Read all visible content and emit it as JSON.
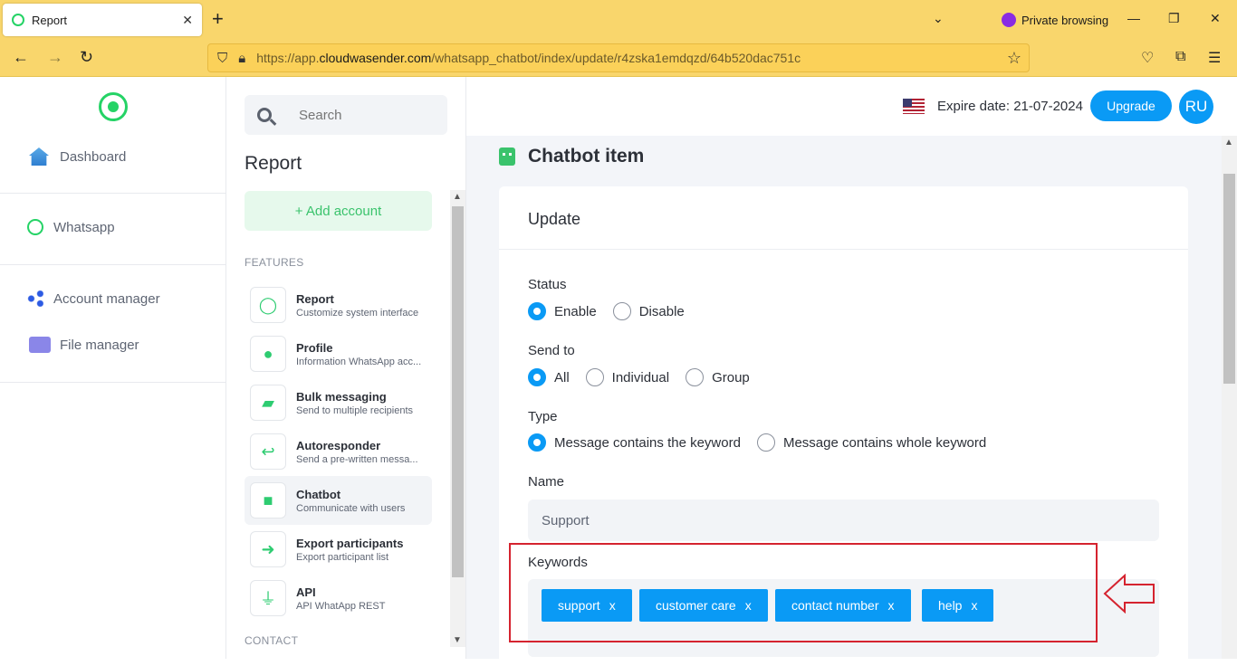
{
  "browser": {
    "tab_title": "Report",
    "tab_close": "✕",
    "new_tab": "+",
    "private_label": "Private browsing",
    "url_prefix": "https://app.",
    "url_domain": "cloudwasender.com",
    "url_path": "/whatsapp_chatbot/index/update/r4zska1emdqzd/64b520dac751c"
  },
  "leftnav": {
    "items": [
      {
        "label": "Dashboard"
      },
      {
        "label": "Whatsapp"
      },
      {
        "label": "Account manager"
      },
      {
        "label": "File manager"
      }
    ]
  },
  "middle": {
    "search_placeholder": "Search",
    "title": "Report",
    "add_account": "+ Add account",
    "features_label": "FEATURES",
    "contact_label": "CONTACT",
    "features": [
      {
        "title": "Report",
        "subtitle": "Customize system interface"
      },
      {
        "title": "Profile",
        "subtitle": "Information WhatsApp acc..."
      },
      {
        "title": "Bulk messaging",
        "subtitle": "Send to multiple recipients"
      },
      {
        "title": "Autoresponder",
        "subtitle": "Send a pre-written messa..."
      },
      {
        "title": "Chatbot",
        "subtitle": "Communicate with users"
      },
      {
        "title": "Export participants",
        "subtitle": "Export participant list"
      },
      {
        "title": "API",
        "subtitle": "API WhatApp REST"
      }
    ]
  },
  "header": {
    "expire": "Expire date: 21-07-2024",
    "upgrade": "Upgrade",
    "avatar": "RU"
  },
  "page": {
    "title": "Chatbot item",
    "card_title": "Update",
    "status_label": "Status",
    "status_options": [
      "Enable",
      "Disable"
    ],
    "status_selected": "Enable",
    "send_to_label": "Send to",
    "send_to_options": [
      "All",
      "Individual",
      "Group"
    ],
    "send_to_selected": "All",
    "type_label": "Type",
    "type_options": [
      "Message contains the keyword",
      "Message contains whole keyword"
    ],
    "type_selected": "Message contains the keyword",
    "name_label": "Name",
    "name_value": "Support",
    "keywords_label": "Keywords",
    "keywords": [
      "support",
      "customer care",
      "contact number",
      "help"
    ],
    "chip_remove": "x"
  },
  "colors": {
    "accent": "#0a9af5",
    "brand_green": "#25d366",
    "highlight_red": "#d5232f"
  }
}
